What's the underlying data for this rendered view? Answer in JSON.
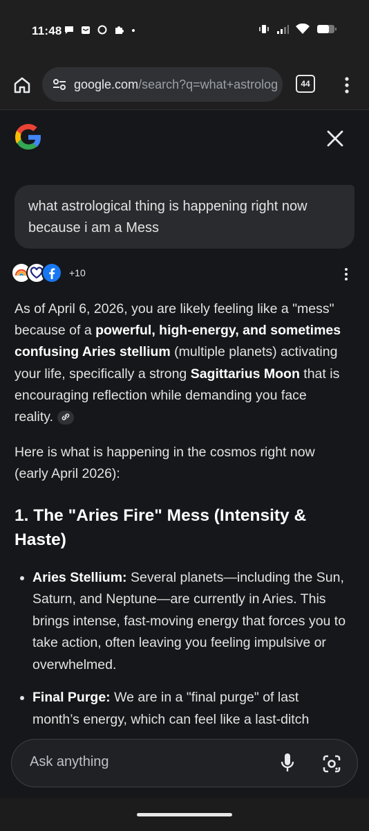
{
  "status_bar": {
    "time": "11:48",
    "notification_icons": [
      "chat-bubble-icon",
      "layers-icon",
      "ring-icon",
      "puzzle-icon",
      "dot-icon"
    ],
    "system_icons": [
      "vibrate-icon",
      "signal-icon",
      "wifi-icon",
      "battery-icon"
    ]
  },
  "browser": {
    "url_host": "google.com",
    "url_path": "/search?q=what+astrolog",
    "tab_count": "44"
  },
  "header": {
    "logo": "google-g-logo",
    "close_icon": "close-icon"
  },
  "query": {
    "text": "what astrological thing is happening right now because i am a Mess"
  },
  "sources": {
    "count_label": "+10",
    "icons": [
      "today-rainbow-icon",
      "heart-icon",
      "facebook-icon"
    ]
  },
  "answer": {
    "p1_a": "As of April 6, 2026, you are likely feeling like a \"mess\" because of a ",
    "p1_b": "powerful, high-energy, and sometimes confusing Aries stellium",
    "p1_c": " (multiple planets) activating your life, specifically a strong ",
    "p1_d": "Sagittarius Moon",
    "p1_e": " that is encouraging reflection while demanding you face reality.",
    "p2": "Here is what is happening in the cosmos right now (early April 2026):",
    "heading": "1. The \"Aries Fire\" Mess (Intensity & Haste)",
    "bullets": [
      {
        "term": "Aries Stellium:",
        "text": " Several planets—including the Sun, Saturn, and Neptune—are currently in Aries. This brings intense, fast-moving energy that forces you to take action, often leaving you feeling impulsive or overwhelmed."
      },
      {
        "term": "Final Purge:",
        "text": " We are in a \"final purge\" of last month’s energy, which can feel like a last-ditch"
      }
    ]
  },
  "ask_bar": {
    "placeholder": "Ask anything",
    "mic_icon": "mic-icon",
    "lens_icon": "camera-search-icon"
  },
  "colors": {
    "background": "#16171a",
    "bubble": "#2a2b2f",
    "text": "#e3e3e3"
  }
}
